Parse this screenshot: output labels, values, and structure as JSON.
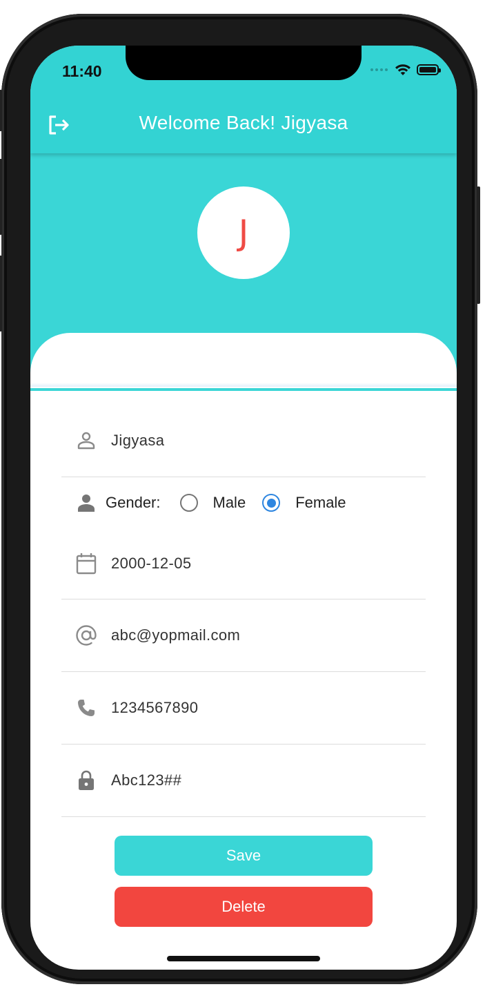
{
  "status_bar": {
    "time": "11:40",
    "icons": [
      "signal-icon",
      "wifi-icon",
      "battery-icon"
    ]
  },
  "app_bar": {
    "title": "Welcome Back! Jigyasa",
    "leading_icon": "logout-icon"
  },
  "profile": {
    "avatar_initial": "J"
  },
  "form": {
    "name": {
      "icon": "person-outline-icon",
      "value": "Jigyasa"
    },
    "gender": {
      "icon": "person-icon",
      "label": "Gender:",
      "options": [
        "Male",
        "Female"
      ],
      "selected": "Female"
    },
    "dob": {
      "icon": "calendar-icon",
      "value": "2000-12-05"
    },
    "email": {
      "icon": "at-icon",
      "value": "abc@yopmail.com"
    },
    "phone": {
      "icon": "phone-icon",
      "value": "1234567890"
    },
    "password": {
      "icon": "lock-icon",
      "value": "Abc123##"
    }
  },
  "buttons": {
    "save_label": "Save",
    "delete_label": "Delete"
  },
  "colors": {
    "primary": "#33d3d3",
    "danger": "#f2463f",
    "avatar_letter": "#ef4b45",
    "radio_selected": "#2e86e0"
  }
}
